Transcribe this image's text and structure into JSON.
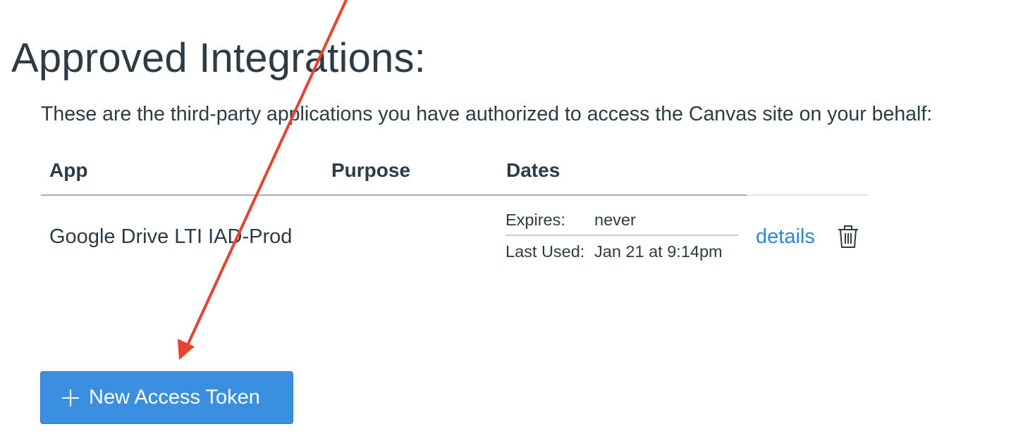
{
  "page": {
    "title": "Approved Integrations:",
    "description": "These are the third-party applications you have authorized to access the Canvas site on your behalf:"
  },
  "table": {
    "headers": {
      "app": "App",
      "purpose": "Purpose",
      "dates": "Dates"
    },
    "rows": [
      {
        "app": "Google Drive LTI IAD-Prod",
        "purpose": "",
        "expires_label": "Expires:",
        "expires_value": "never",
        "last_used_label": "Last Used:",
        "last_used_value": "Jan 21 at 9:14pm",
        "details_label": "details",
        "delete_icon": "trash-icon"
      }
    ]
  },
  "actions": {
    "new_token_label": "New Access Token",
    "new_token_icon": "plus-icon"
  },
  "colors": {
    "text": "#2d3b45",
    "link": "#2d86d7",
    "primary_button": "#3a8fe0",
    "annotation_arrow": "#e8432e"
  }
}
